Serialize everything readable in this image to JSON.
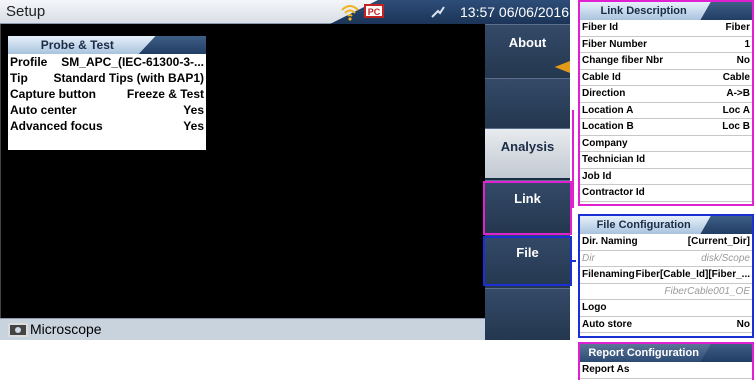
{
  "window": {
    "title": "Setup",
    "clock": "13:57 06/06/2016"
  },
  "probe_panel": {
    "header": "Probe & Test",
    "rows": [
      {
        "label": "Profile",
        "value": "SM_APC_(IEC-61300-3-..."
      },
      {
        "label": "Tip",
        "value": "Standard Tips (with BAP1)"
      },
      {
        "label": "Capture button",
        "value": "Freeze & Test"
      },
      {
        "label": "Auto center",
        "value": "Yes"
      },
      {
        "label": "Advanced focus",
        "value": "Yes"
      }
    ]
  },
  "footer": {
    "label": "Microscope"
  },
  "sidebar": {
    "about": "About",
    "analysis": "Analysis",
    "link": "Link",
    "file": "File"
  },
  "link_description": {
    "header": "Link Description",
    "rows": [
      {
        "label": "Fiber Id",
        "value": "Fiber"
      },
      {
        "label": "Fiber Number",
        "value": "1"
      },
      {
        "label": "Change fiber Nbr",
        "value": "No"
      },
      {
        "label": "Cable Id",
        "value": "Cable"
      },
      {
        "label": "Direction",
        "value": "A->B"
      },
      {
        "label": "Location A",
        "value": "Loc A"
      },
      {
        "label": "Location B",
        "value": "Loc B"
      },
      {
        "label": "Company",
        "value": ""
      },
      {
        "label": "Technician Id",
        "value": ""
      },
      {
        "label": "Job Id",
        "value": ""
      },
      {
        "label": "Contractor Id",
        "value": ""
      }
    ]
  },
  "file_configuration": {
    "header": "File Configuration",
    "rows": [
      {
        "label": "Dir. Naming",
        "value": "[Current_Dir]"
      },
      {
        "label": "Dir",
        "value": "disk/Scope"
      },
      {
        "label": "Filenaming",
        "value": "Fiber[Cable_Id][Fiber_..."
      },
      {
        "label": "",
        "value": "FiberCable001_OE"
      },
      {
        "label": "Logo",
        "value": ""
      },
      {
        "label": "Auto store",
        "value": "No"
      }
    ]
  },
  "report_configuration": {
    "header": "Report Configuration",
    "rows": [
      {
        "label": "Report As",
        "value": ""
      }
    ]
  }
}
